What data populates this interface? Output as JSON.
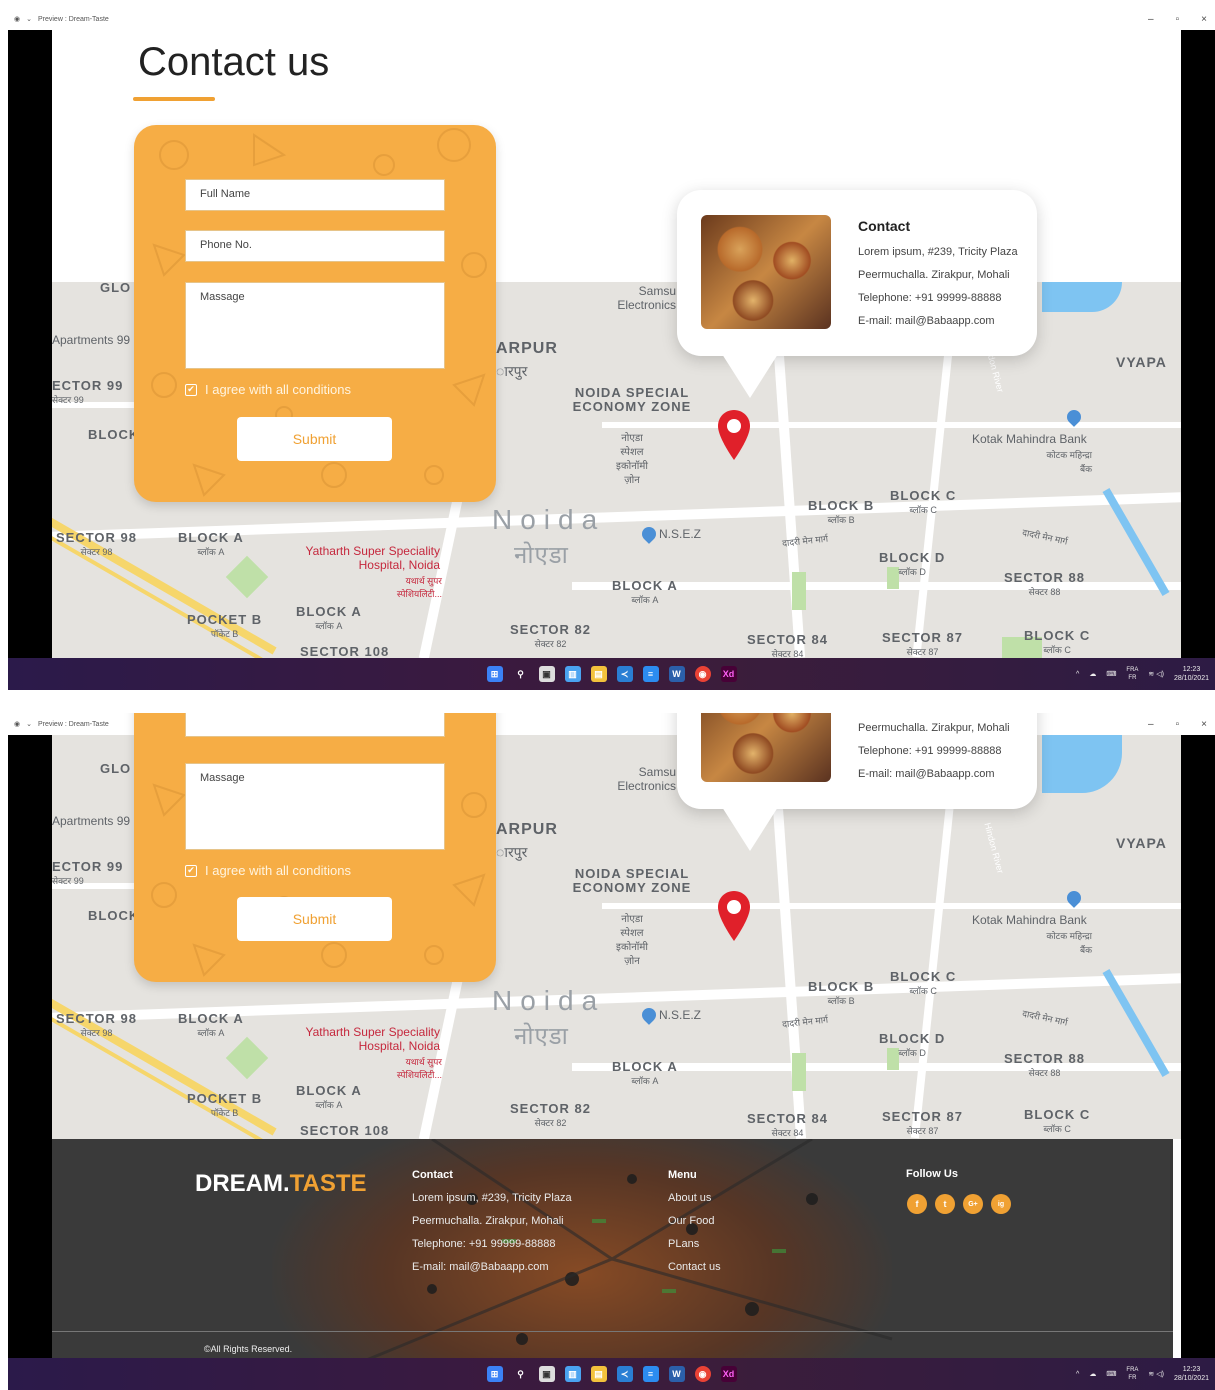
{
  "window": {
    "title": "Preview : Dream-Taste"
  },
  "page": {
    "title": "Contact us"
  },
  "form": {
    "full_name_placeholder": "Full Name",
    "phone_placeholder": "Phone No.",
    "message_placeholder": "Massage",
    "agree_label": "I agree with all conditions",
    "submit_label": "Submit"
  },
  "contact_card": {
    "title": "Contact",
    "address_line1": "Lorem ipsum, #239, Tricity Plaza",
    "address_line2": "Peermuchalla. Zirakpur, Mohali",
    "telephone": "Telephone: +91 99999-88888",
    "email": "E-mail: mail@Babaapp.com"
  },
  "map": {
    "labels": [
      {
        "name": "BLOCK C",
        "sub": "ब्लॉक C"
      },
      {
        "name": "BLOCK B",
        "sub": "ब्लॉक B"
      },
      {
        "name": "BLOCK D",
        "sub": "ब्लॉक D"
      },
      {
        "name": "SECTOR 88",
        "sub": "सेक्टर 88"
      },
      {
        "name": "SECTOR 98",
        "sub": "सेक्टर 98"
      },
      {
        "name": "BLOCK A",
        "sub": "ब्लॉक A"
      },
      {
        "name": "POCKET B",
        "sub": "पॉकेट B"
      },
      {
        "name": "SECTOR 82",
        "sub": "सेक्टर 82"
      },
      {
        "name": "SECTOR 84",
        "sub": "सेक्टर 84"
      },
      {
        "name": "SECTOR 87",
        "sub": "सेक्टर 87"
      },
      {
        "name": "SECTOR 108",
        "sub": ""
      },
      {
        "name": "NOIDA SPECIAL ECONOMY ZONE",
        "sub": "नोएडा स्पेशल इकोनॉमी ज़ोन"
      }
    ],
    "noida": "Noida",
    "noida_hi": "नोएडा",
    "nsez": "N.S.E.Z",
    "hospital": "Yatharth Super Speciality Hospital, Noida",
    "hospital_hi": "यथार्थ सुपर स्पेशियलिटी...",
    "bank": "Kotak Mahindra Bank",
    "bank_hi": "कोटक महिन्द्रा बैंक",
    "samsung": "Samsu Electronics",
    "arpur": "ARPUR",
    "arpur_hi": "ारपुर",
    "apartments": "Apartments 99 HIG MIG",
    "ector99": "ECTOR 99",
    "ector99_hi": "सेक्टर 99",
    "blockk": "BLOCK",
    "glo": "GLO",
    "vyapa": "VYAPA",
    "hindon": "Hindon River",
    "dadri": "दादरी मेन मार्ग"
  },
  "footer": {
    "logo_main": "DREAM.",
    "logo_accent": "TASTE",
    "contact_title": "Contact",
    "contact_lines": [
      "Lorem ipsum, #239, Tricity Plaza",
      "Peermuchalla. Zirakpur, Mohali",
      "Telephone: +91 99999-88888",
      "E-mail: mail@Babaapp.com"
    ],
    "menu_title": "Menu",
    "menu_items": [
      "About us",
      "Our Food",
      "PLans",
      "Contact us"
    ],
    "follow_title": "Follow Us",
    "social": [
      "f",
      "t",
      "G+",
      "ig"
    ],
    "copyright": "©All Rights Reserved."
  },
  "taskbar": {
    "lang_top": "FRA",
    "lang_bottom": "FR",
    "time": "12:23",
    "date": "28/10/2021",
    "xd_label": "Xd"
  },
  "colors": {
    "accent": "#f0a133",
    "form_bg": "#f6ad45",
    "footer_bg": "#3a3a3a",
    "pin_red": "#e0202a"
  }
}
